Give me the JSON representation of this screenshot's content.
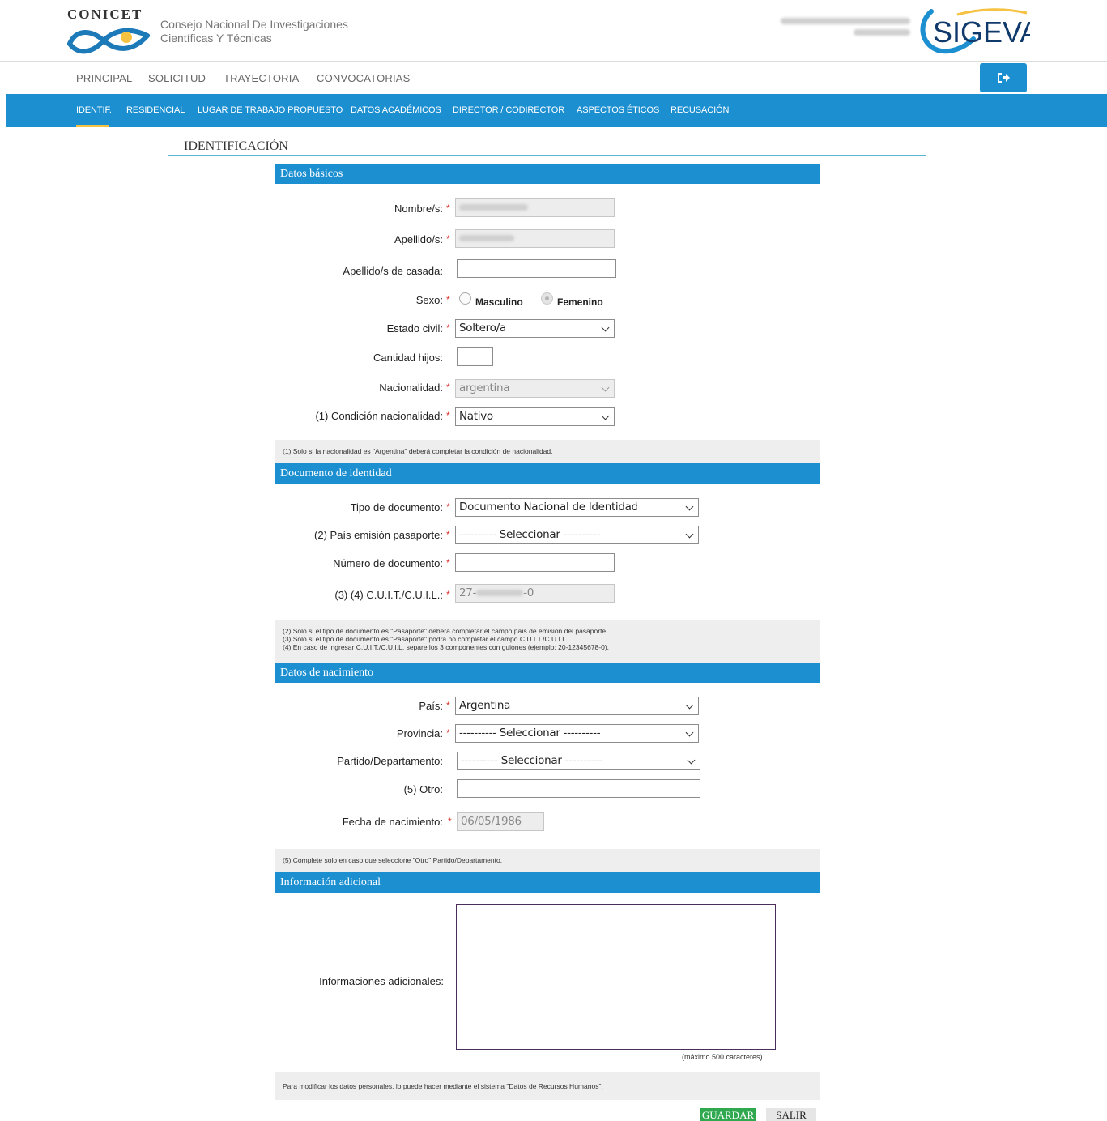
{
  "header": {
    "brand": "CONICET",
    "subtitle_line1": "Consejo Nacional De Investigaciones",
    "subtitle_line2": "Científicas Y Técnicas",
    "system_logo": "SIGEVA"
  },
  "main_menu": {
    "items": [
      "PRINCIPAL",
      "SOLICITUD",
      "TRAYECTORIA",
      "CONVOCATORIAS"
    ],
    "logout_icon": "sign-out-icon"
  },
  "tabs": [
    "IDENTIF.",
    "RESIDENCIAL",
    "LUGAR DE TRABAJO PROPUESTO",
    "DATOS ACADÉMICOS",
    "DIRECTOR / CODIRECTOR",
    "ASPECTOS ÉTICOS",
    "RECUSACIÓN"
  ],
  "active_tab": "IDENTIF.",
  "page_title": "IDENTIFICACIÓN",
  "colors": {
    "primary": "#1c8fd1",
    "accent_tab": "#f5c242",
    "required": "#e0302a",
    "save_button": "#2fa84f"
  },
  "sections": {
    "basicos": {
      "title": "Datos básicos",
      "nombre_label": "Nombre/s:",
      "apellido_label": "Apellido/s:",
      "casada_label": "Apellido/s de casada:",
      "sexo_label": "Sexo:",
      "sexo_opt1": "Masculino",
      "sexo_opt2": "Femenino",
      "estado_label": "Estado civil:",
      "estado_value": "Soltero/a",
      "hijos_label": "Cantidad hijos:",
      "nacionalidad_label": "Nacionalidad:",
      "nacionalidad_value": "argentina",
      "condicion_label": "(1) Condición nacionalidad:",
      "condicion_value": "Nativo",
      "note": "(1) Solo si la nacionalidad es \"Argentina\" deberá completar la condición de nacionalidad."
    },
    "documento": {
      "title": "Documento de identidad",
      "tipo_label": "Tipo de documento:",
      "tipo_value": "Documento Nacional de Identidad",
      "pais_label": "(2) País emisión pasaporte:",
      "pais_value": "---------- Seleccionar ----------",
      "numero_label": "Número de documento:",
      "cuit_label": "(3) (4) C.U.I.T./C.U.I.L.:",
      "cuit_prefix": "27-",
      "cuit_suffix": "-0",
      "note1": "(2) Solo si el tipo de documento es \"Pasaporte\" deberá completar el campo país de emisión del pasaporte.",
      "note2": "(3) Solo si el tipo de documento es \"Pasaporte\" podrá no completar el campo C.U.I.T./C.U.I.L.",
      "note3": "(4) En caso de ingresar C.U.I.T./C.U.I.L. separe los 3 componentes con guiones (ejemplo: 20-12345678-0)."
    },
    "nacimiento": {
      "title": "Datos de nacimiento",
      "pais_label": "País:",
      "pais_value": "Argentina",
      "provincia_label": "Provincia:",
      "provincia_value": "---------- Seleccionar ----------",
      "partido_label": "Partido/Departamento:",
      "partido_value": "---------- Seleccionar ----------",
      "otro_label": "(5) Otro:",
      "fecha_label": "Fecha de nacimiento:",
      "fecha_value": "06/05/1986",
      "note": "(5) Complete solo en caso que seleccione \"Otro\" Partido/Departamento."
    },
    "adicional": {
      "title": "Información adicional",
      "info_label": "Informaciones adicionales:",
      "max_chars": "(máximo 500 caracteres)",
      "note": "Para modificar los datos personales, lo puede hacer mediante el sistema \"Datos de Recursos Humanos\"."
    }
  },
  "required_mark": "*",
  "buttons": {
    "save": "GUARDAR",
    "exit": "SALIR"
  }
}
